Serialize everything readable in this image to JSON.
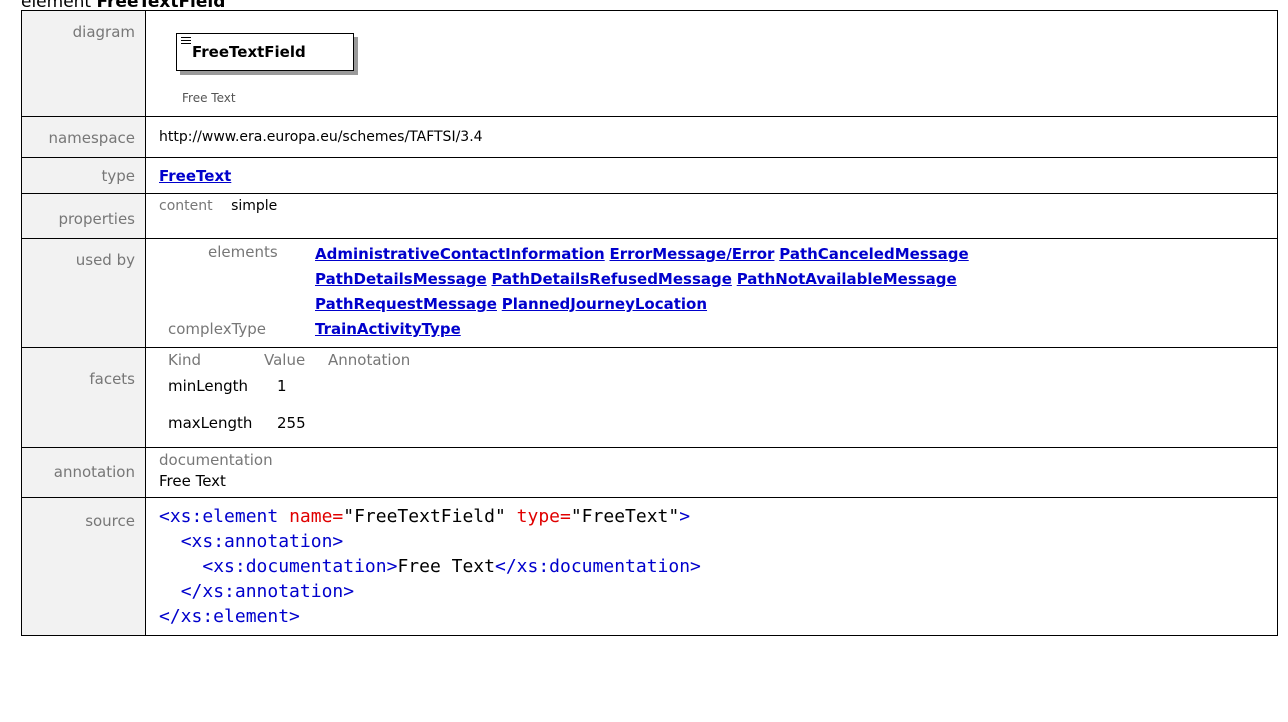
{
  "heading": {
    "prefix": "element",
    "name": "FreeTextField"
  },
  "rows": {
    "diagram": {
      "label": "diagram",
      "element_name": "FreeTextField",
      "caption": "Free Text"
    },
    "namespace": {
      "label": "namespace",
      "value": "http://www.era.europa.eu/schemes/TAFTSI/3.4"
    },
    "type": {
      "label": "type",
      "value": "FreeText"
    },
    "properties": {
      "label": "properties",
      "key": "content",
      "value": "simple"
    },
    "used_by": {
      "label": "used by",
      "elements_label": "elements",
      "elements": [
        "AdministrativeContactInformation",
        "ErrorMessage/Error",
        "PathCanceledMessage",
        "PathDetailsMessage",
        "PathDetailsRefusedMessage",
        "PathNotAvailableMessage",
        "PathRequestMessage",
        "PlannedJourneyLocation"
      ],
      "complextype_label": "complexType",
      "complextypes": [
        "TrainActivityType"
      ]
    },
    "facets": {
      "label": "facets",
      "headers": [
        "Kind",
        "Value",
        "Annotation"
      ],
      "items": [
        {
          "kind": "minLength",
          "value": "1"
        },
        {
          "kind": "maxLength",
          "value": "255"
        }
      ]
    },
    "annotation": {
      "label": "annotation",
      "sub_label": "documentation",
      "text": "Free Text"
    },
    "source": {
      "label": "source",
      "lines": {
        "l1_open": "<xs:element",
        "l1_attr1": "name=",
        "l1_val1": "\"FreeTextField\"",
        "l1_attr2": "type=",
        "l1_val2": "\"FreeText\"",
        "l1_close": ">",
        "l2": "<xs:annotation>",
        "l3_open": "<xs:documentation>",
        "l3_text": "Free Text",
        "l3_close": "</xs:documentation>",
        "l4": "</xs:annotation>",
        "l5": "</xs:element>"
      }
    }
  }
}
